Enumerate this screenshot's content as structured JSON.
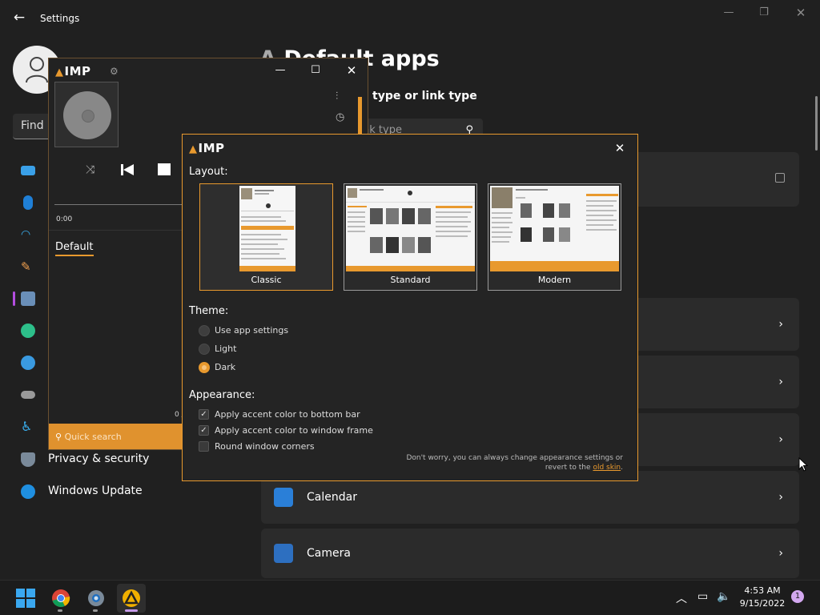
{
  "settings": {
    "title": "Settings",
    "search_placeholder": "Find a",
    "page_title_muted": "A",
    "page_title": "Default apps",
    "subheading": "type or link type",
    "link_search_placeholder": "nk type",
    "nav": [
      {
        "label": "Privacy & security"
      },
      {
        "label": "Windows Update"
      }
    ],
    "apps": [
      {
        "name": "Calendar"
      },
      {
        "name": "Camera"
      }
    ]
  },
  "player": {
    "logo": "IMP",
    "time": "0:00",
    "playlist_tab": "Default",
    "count": "0 /",
    "quick_search": "Quick search"
  },
  "dialog": {
    "logo": "IMP",
    "layout_title": "Layout:",
    "layouts": [
      {
        "label": "Classic",
        "selected": true
      },
      {
        "label": "Standard",
        "selected": false
      },
      {
        "label": "Modern",
        "selected": false
      }
    ],
    "theme_title": "Theme:",
    "themes": [
      {
        "label": "Use app settings",
        "selected": false
      },
      {
        "label": "Light",
        "selected": false
      },
      {
        "label": "Dark",
        "selected": true
      }
    ],
    "appearance_title": "Appearance:",
    "appearance": [
      {
        "label": "Apply accent color to bottom bar",
        "checked": true
      },
      {
        "label": "Apply accent color to window frame",
        "checked": true
      },
      {
        "label": "Round window corners",
        "checked": false
      }
    ],
    "hint_text": "Don't worry, you can always change appearance settings or revert to the",
    "hint_link": "old skin",
    "hint_end": "."
  },
  "taskbar": {
    "time": "4:53 AM",
    "date": "9/15/2022",
    "notification_count": "1"
  },
  "colors": {
    "accent": "#e8992e",
    "background": "#202020",
    "card": "#2b2b2b"
  }
}
